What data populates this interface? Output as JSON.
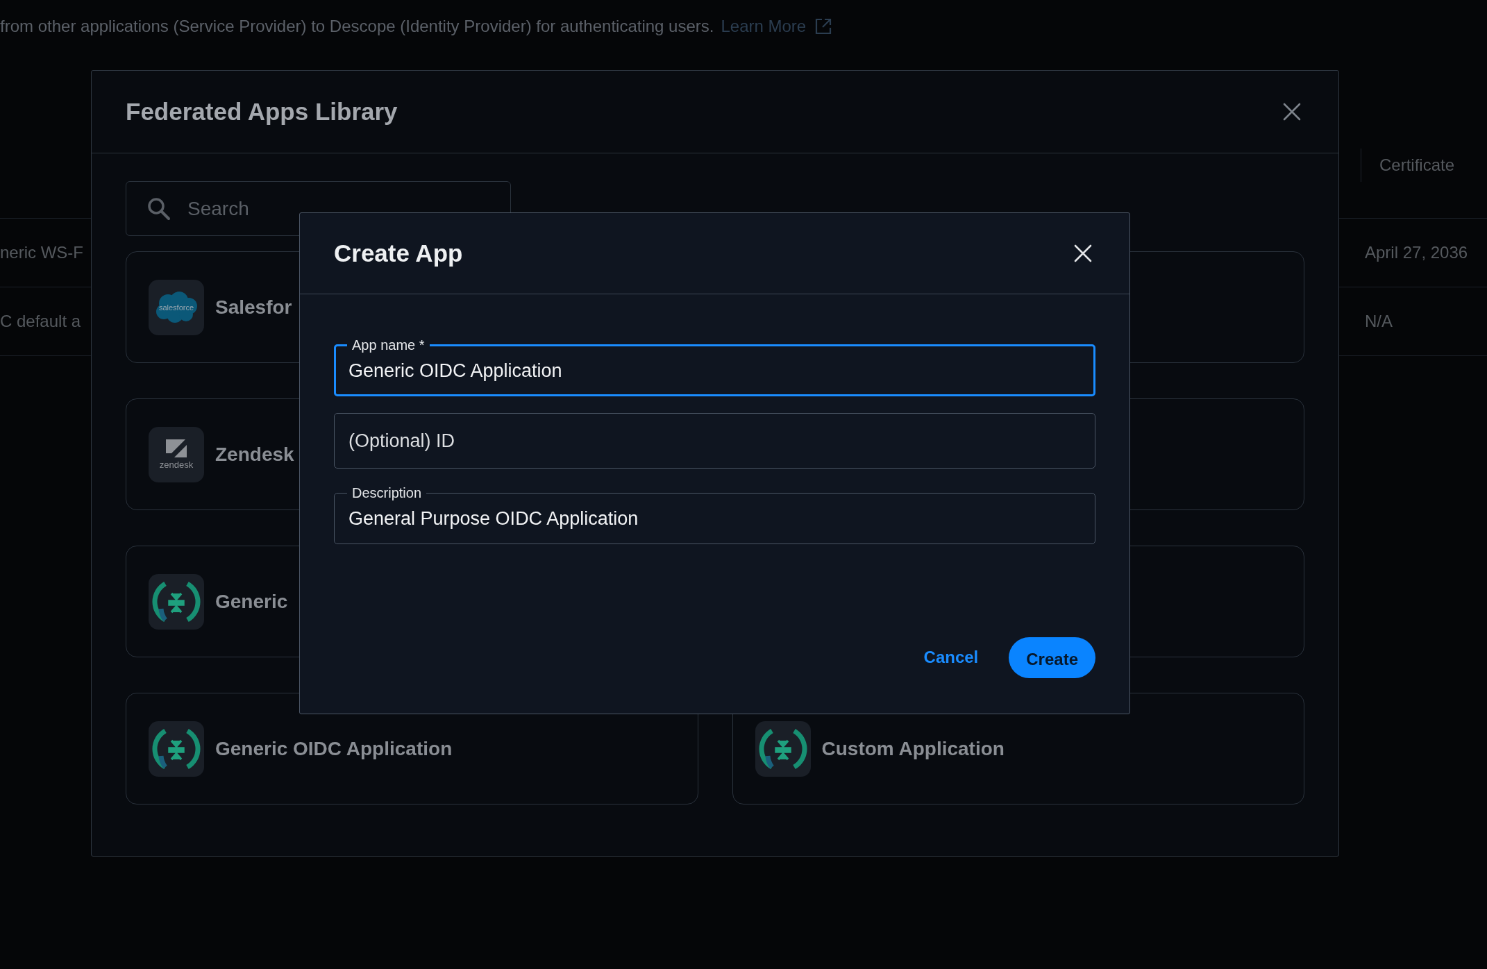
{
  "page": {
    "description": "from other applications (Service Provider) to Descope (Identity Provider) for authenticating users.",
    "learn_more": "Learn More"
  },
  "background_table": {
    "header": "Certificate",
    "rows": [
      {
        "name": "neric WS-F",
        "certificate": "April 27, 2036"
      },
      {
        "name": "C default a",
        "certificate": "N/A"
      }
    ]
  },
  "library": {
    "title": "Federated Apps Library",
    "search": {
      "placeholder": "Search"
    },
    "cards": [
      {
        "kind": "app",
        "name": "Salesfor",
        "logo": {
          "kind": "salesforce",
          "text": "salesforce"
        }
      },
      {
        "kind": "covered"
      },
      {
        "kind": "app",
        "name": "Zendesk",
        "logo": {
          "kind": "zendesk",
          "text": "zendesk"
        }
      },
      {
        "kind": "covered"
      },
      {
        "kind": "app",
        "name": "Generic",
        "logo": {
          "kind": "descope"
        }
      },
      {
        "kind": "covered"
      },
      {
        "kind": "app",
        "name": "Generic OIDC Application",
        "logo": {
          "kind": "descope"
        }
      },
      {
        "kind": "app",
        "name": "Custom Application",
        "logo": {
          "kind": "descope"
        }
      }
    ]
  },
  "create_app": {
    "title": "Create App",
    "fields": [
      {
        "label": "App name *",
        "value": "Generic OIDC Application",
        "focused": true
      },
      {
        "placeholder": "(Optional) ID",
        "focused": false
      },
      {
        "label": "Description",
        "value": "General Purpose OIDC Application",
        "focused": false
      }
    ],
    "buttons": [
      {
        "label": "Cancel",
        "kind": "text"
      },
      {
        "label": "Create",
        "kind": "primary"
      }
    ]
  }
}
